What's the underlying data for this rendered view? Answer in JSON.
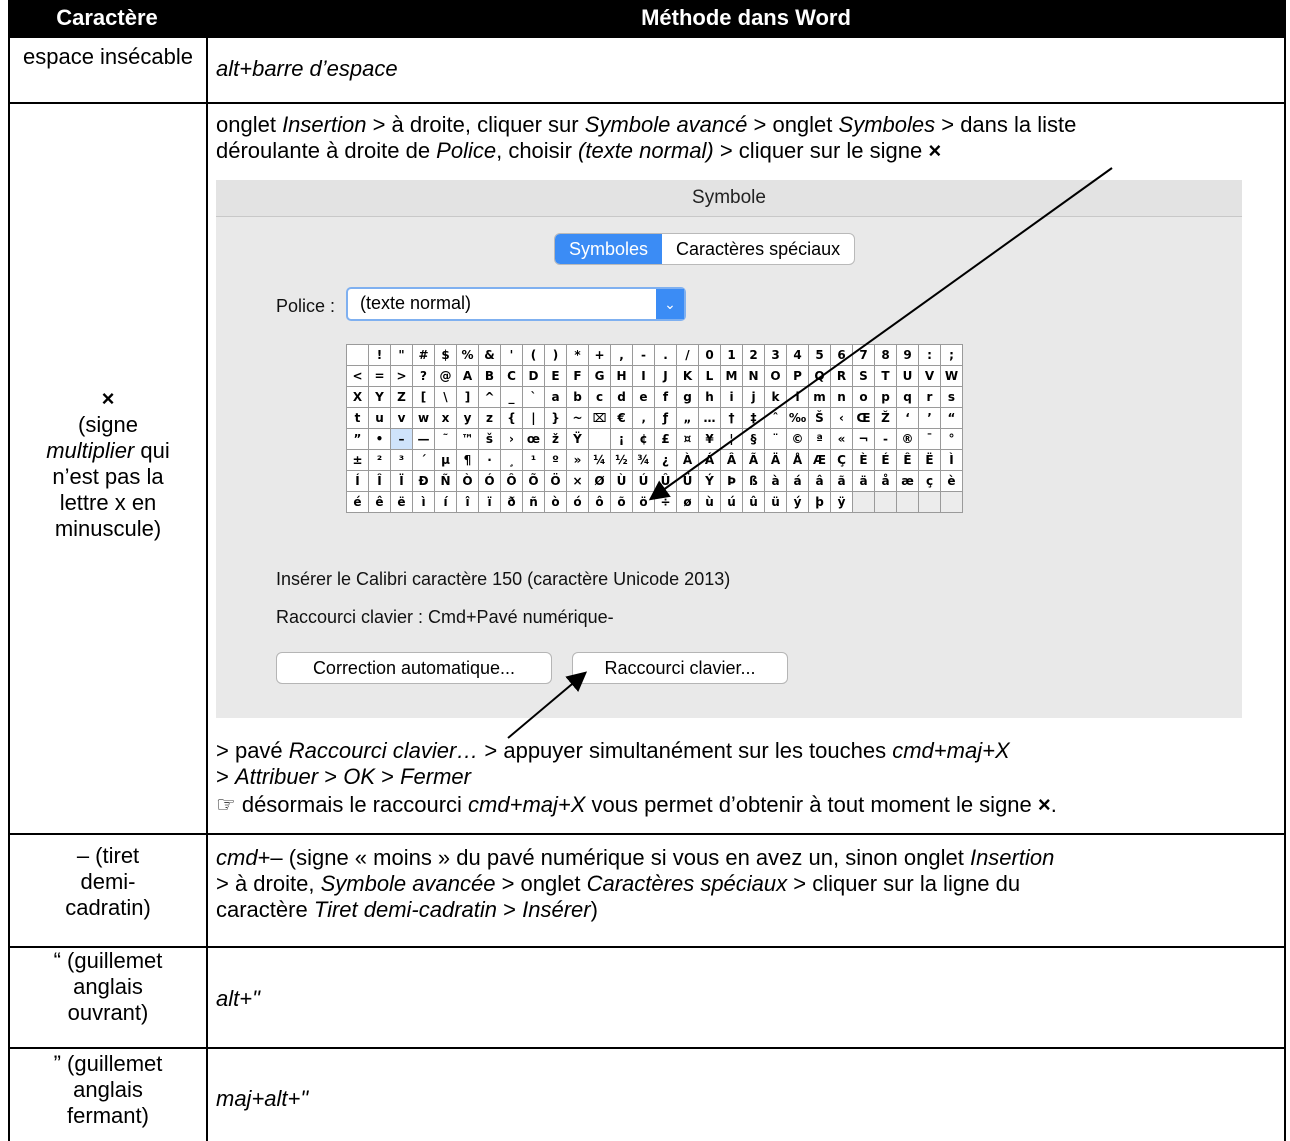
{
  "table": {
    "headers": {
      "col1": "Caractère",
      "col2": "Méthode dans Word"
    },
    "rows": [
      {
        "char": "espace insécable",
        "method": "alt+barre d’espace"
      },
      {
        "char_symbol": "×",
        "char_lines": [
          "(signe",
          "multiplier qui",
          "n’est pas la",
          "lettre x en",
          "minuscule)"
        ],
        "intro_line1": [
          {
            "t": "onglet "
          },
          {
            "t": "Insertion",
            "i": true
          },
          {
            "t": " > à droite, cliquer sur "
          },
          {
            "t": "Symbole avancé",
            "i": true
          },
          {
            "t": " > onglet "
          },
          {
            "t": "Symboles",
            "i": true
          },
          {
            "t": " > dans la liste"
          }
        ],
        "intro_line2": [
          {
            "t": "déroulante à droite de "
          },
          {
            "t": "Police",
            "i": true
          },
          {
            "t": ", choisir "
          },
          {
            "t": "(texte normal)",
            "i": true
          },
          {
            "t": " > cliquer sur le signe "
          },
          {
            "t": "×",
            "b": true
          }
        ],
        "after_line1": [
          {
            "t": "> pavé "
          },
          {
            "t": "Raccourci clavier…",
            "i": true
          },
          {
            "t": " > appuyer simultanément sur les touches "
          },
          {
            "t": "cmd+maj+X",
            "i": true
          }
        ],
        "after_line2": [
          {
            "t": "> "
          },
          {
            "t": "Attribuer",
            "i": true
          },
          {
            "t": " > "
          },
          {
            "t": "OK",
            "i": true
          },
          {
            "t": " > "
          },
          {
            "t": "Fermer",
            "i": true
          }
        ],
        "after_line3": [
          {
            "t": "☞ désormais le raccourci "
          },
          {
            "t": "cmd+maj+X",
            "i": true
          },
          {
            "t": " vous permet d’obtenir à tout moment le signe "
          },
          {
            "t": "×",
            "b": true
          },
          {
            "t": "."
          }
        ]
      },
      {
        "char_lines": [
          "–      (tiret",
          "demi-",
          "cadratin)"
        ],
        "method_lines": [
          [
            {
              "t": "cmd",
              "i": true
            },
            {
              "t": "+– (signe « moins » du pavé numérique si vous en avez un, sinon onglet "
            },
            {
              "t": "Insertion",
              "i": true
            }
          ],
          [
            {
              "t": "> à droite, "
            },
            {
              "t": "Symbole avancée",
              "i": true
            },
            {
              "t": " > onglet "
            },
            {
              "t": "Caractères spéciaux",
              "i": true
            },
            {
              "t": " > cliquer sur la ligne du"
            }
          ],
          [
            {
              "t": "caractère "
            },
            {
              "t": "Tiret demi-cadratin",
              "i": true
            },
            {
              "t": " > "
            },
            {
              "t": "Insérer",
              "i": true
            },
            {
              "t": ")"
            }
          ]
        ]
      },
      {
        "char_lines": [
          "“ (guillemet",
          "anglais",
          "ouvrant)"
        ],
        "method": "alt+\""
      },
      {
        "char_lines": [
          "” (guillemet",
          "anglais",
          "fermant)"
        ],
        "method": "maj+alt+\""
      }
    ]
  },
  "dialog": {
    "title": "Symbole",
    "tabs": [
      "Symboles",
      "Caractères spéciaux"
    ],
    "police_label": "Police :",
    "police_value": "(texte normal)",
    "dropdown_icon": "chevron-down-icon",
    "symbols": [
      [
        " ",
        "!",
        "\"",
        "#",
        "$",
        "%",
        "&",
        "'",
        "(",
        ")",
        "*",
        "+",
        ",",
        "-",
        ".",
        "/",
        "0",
        "1",
        "2",
        "3",
        "4",
        "5",
        "6",
        "7",
        "8",
        "9",
        ":",
        ";"
      ],
      [
        "<",
        "=",
        ">",
        "?",
        "@",
        "A",
        "B",
        "C",
        "D",
        "E",
        "F",
        "G",
        "H",
        "I",
        "J",
        "K",
        "L",
        "M",
        "N",
        "O",
        "P",
        "Q",
        "R",
        "S",
        "T",
        "U",
        "V",
        "W"
      ],
      [
        "X",
        "Y",
        "Z",
        "[",
        "\\",
        "]",
        "^",
        "_",
        "`",
        "a",
        "b",
        "c",
        "d",
        "e",
        "f",
        "g",
        "h",
        "i",
        "j",
        "k",
        "l",
        "m",
        "n",
        "o",
        "p",
        "q",
        "r",
        "s"
      ],
      [
        "t",
        "u",
        "v",
        "w",
        "x",
        "y",
        "z",
        "{",
        "|",
        "}",
        "~",
        "⌧",
        "€",
        "‚",
        "ƒ",
        "„",
        "…",
        "†",
        "‡",
        "ˆ",
        "‰",
        "Š",
        "‹",
        "Œ",
        "Ž",
        "‘",
        "’",
        "“"
      ],
      [
        "”",
        "•",
        "–",
        "—",
        "˜",
        "™",
        "š",
        "›",
        "œ",
        "ž",
        "Ÿ",
        " ",
        "¡",
        "¢",
        "£",
        "¤",
        "¥",
        "¦",
        "§",
        "¨",
        "©",
        "ª",
        "«",
        "¬",
        "-",
        "®",
        "¯",
        "°"
      ],
      [
        "±",
        "²",
        "³",
        "´",
        "µ",
        "¶",
        "·",
        "¸",
        "¹",
        "º",
        "»",
        "¼",
        "½",
        "¾",
        "¿",
        "À",
        "Á",
        "Â",
        "Ã",
        "Ä",
        "Å",
        "Æ",
        "Ç",
        "È",
        "É",
        "Ê",
        "Ë",
        "Ì"
      ],
      [
        "Í",
        "Î",
        "Ï",
        "Ð",
        "Ñ",
        "Ò",
        "Ó",
        "Ô",
        "Õ",
        "Ö",
        "×",
        "Ø",
        "Ù",
        "Ú",
        "Û",
        "Ü",
        "Ý",
        "Þ",
        "ß",
        "à",
        "á",
        "â",
        "ã",
        "ä",
        "å",
        "æ",
        "ç",
        "è"
      ],
      [
        "é",
        "ê",
        "ë",
        "ì",
        "í",
        "î",
        "ï",
        "ð",
        "ñ",
        "ò",
        "ó",
        "ô",
        "õ",
        "ö",
        "÷",
        "ø",
        "ù",
        "ú",
        "û",
        "ü",
        "ý",
        "þ",
        "ÿ",
        "",
        "",
        "",
        "",
        ""
      ]
    ],
    "insert_text": "Insérer le Calibri caractère 150 (caractère Unicode 2013)",
    "shortcut_text": "Raccourci clavier :  Cmd+Pavé numérique-",
    "btn_autocorrect": "Correction automatique...",
    "btn_shortcut": "Raccourci clavier..."
  }
}
